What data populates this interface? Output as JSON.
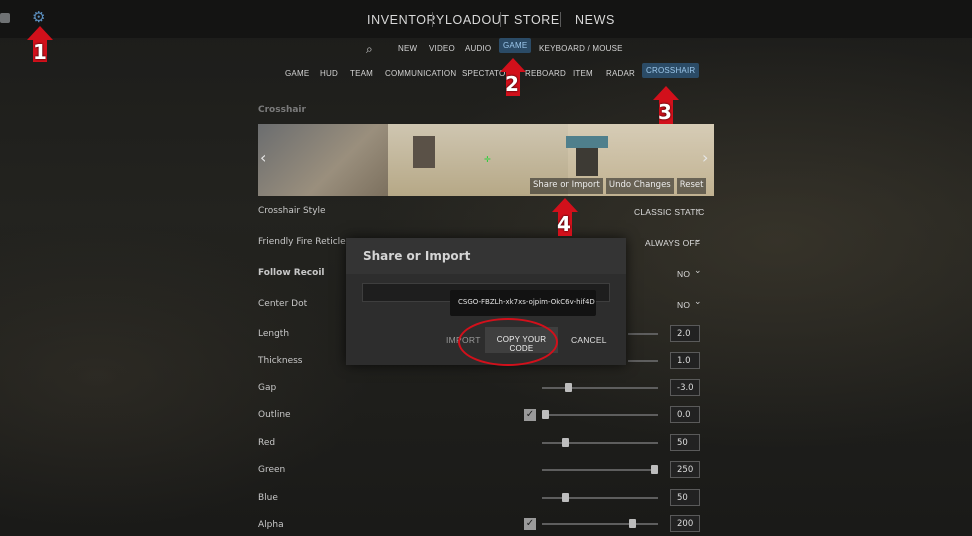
{
  "top_nav": {
    "items": [
      "INVENTORY",
      "LOADOUT",
      "STORE",
      "NEWS"
    ]
  },
  "settings_categories": [
    "NEW",
    "VIDEO",
    "AUDIO",
    "GAME",
    "KEYBOARD / MOUSE"
  ],
  "settings_categories_active": "GAME",
  "game_subtabs": [
    "GAME",
    "HUD",
    "TEAM",
    "COMMUNICATION",
    "SPECTATOR",
    "SCOREBOARD",
    "ITEM",
    "RADAR",
    "CROSSHAIR"
  ],
  "game_subtabs_visible": {
    "game": "GAME",
    "hud": "HUD",
    "team": "TEAM",
    "communication": "COMMUNICATION",
    "spectator": "SPECTATO",
    "scoreboard": "REBOARD",
    "item": "ITEM",
    "radar": "RADAR",
    "crosshair": "CROSSHAIR"
  },
  "game_subtabs_active": "CROSSHAIR",
  "section": {
    "title": "Crosshair",
    "preview_buttons": {
      "share": "Share or Import",
      "undo": "Undo Changes",
      "reset": "Reset"
    }
  },
  "settings": {
    "style": {
      "label": "Crosshair Style",
      "value": "CLASSIC STATIC"
    },
    "friendly_fire": {
      "label": "Friendly Fire Reticle",
      "value": "ALWAYS OFF"
    },
    "follow_recoil": {
      "label": "Follow Recoil",
      "value": "NO"
    },
    "center_dot": {
      "label": "Center Dot",
      "value": "NO"
    },
    "length": {
      "label": "Length",
      "value": "2.0"
    },
    "thickness": {
      "label": "Thickness",
      "value": "1.0"
    },
    "gap": {
      "label": "Gap",
      "value": "-3.0",
      "fill": 0.22
    },
    "outline": {
      "label": "Outline",
      "value": "0.0",
      "fill": 0.0,
      "checked": true
    },
    "red": {
      "label": "Red",
      "value": "50",
      "fill": 0.2
    },
    "green": {
      "label": "Green",
      "value": "250",
      "fill": 0.98
    },
    "blue": {
      "label": "Blue",
      "value": "50",
      "fill": 0.2
    },
    "alpha": {
      "label": "Alpha",
      "value": "200",
      "fill": 0.78,
      "checked": true
    }
  },
  "modal": {
    "title": "Share or Import",
    "code": "CSGO-FBZLh-xk7xs-ojpim-OkC6v-hif4D",
    "import_label": "IMPORT",
    "copy_label": "COPY YOUR CODE",
    "cancel_label": "CANCEL"
  },
  "annotations": [
    "1",
    "2",
    "3",
    "4"
  ],
  "colors": {
    "annotation_red": "#d2101b",
    "active_tab_bg": "#2b4b66",
    "active_tab_text": "#9cc8ec",
    "gear_blue": "#5b8fbf"
  }
}
